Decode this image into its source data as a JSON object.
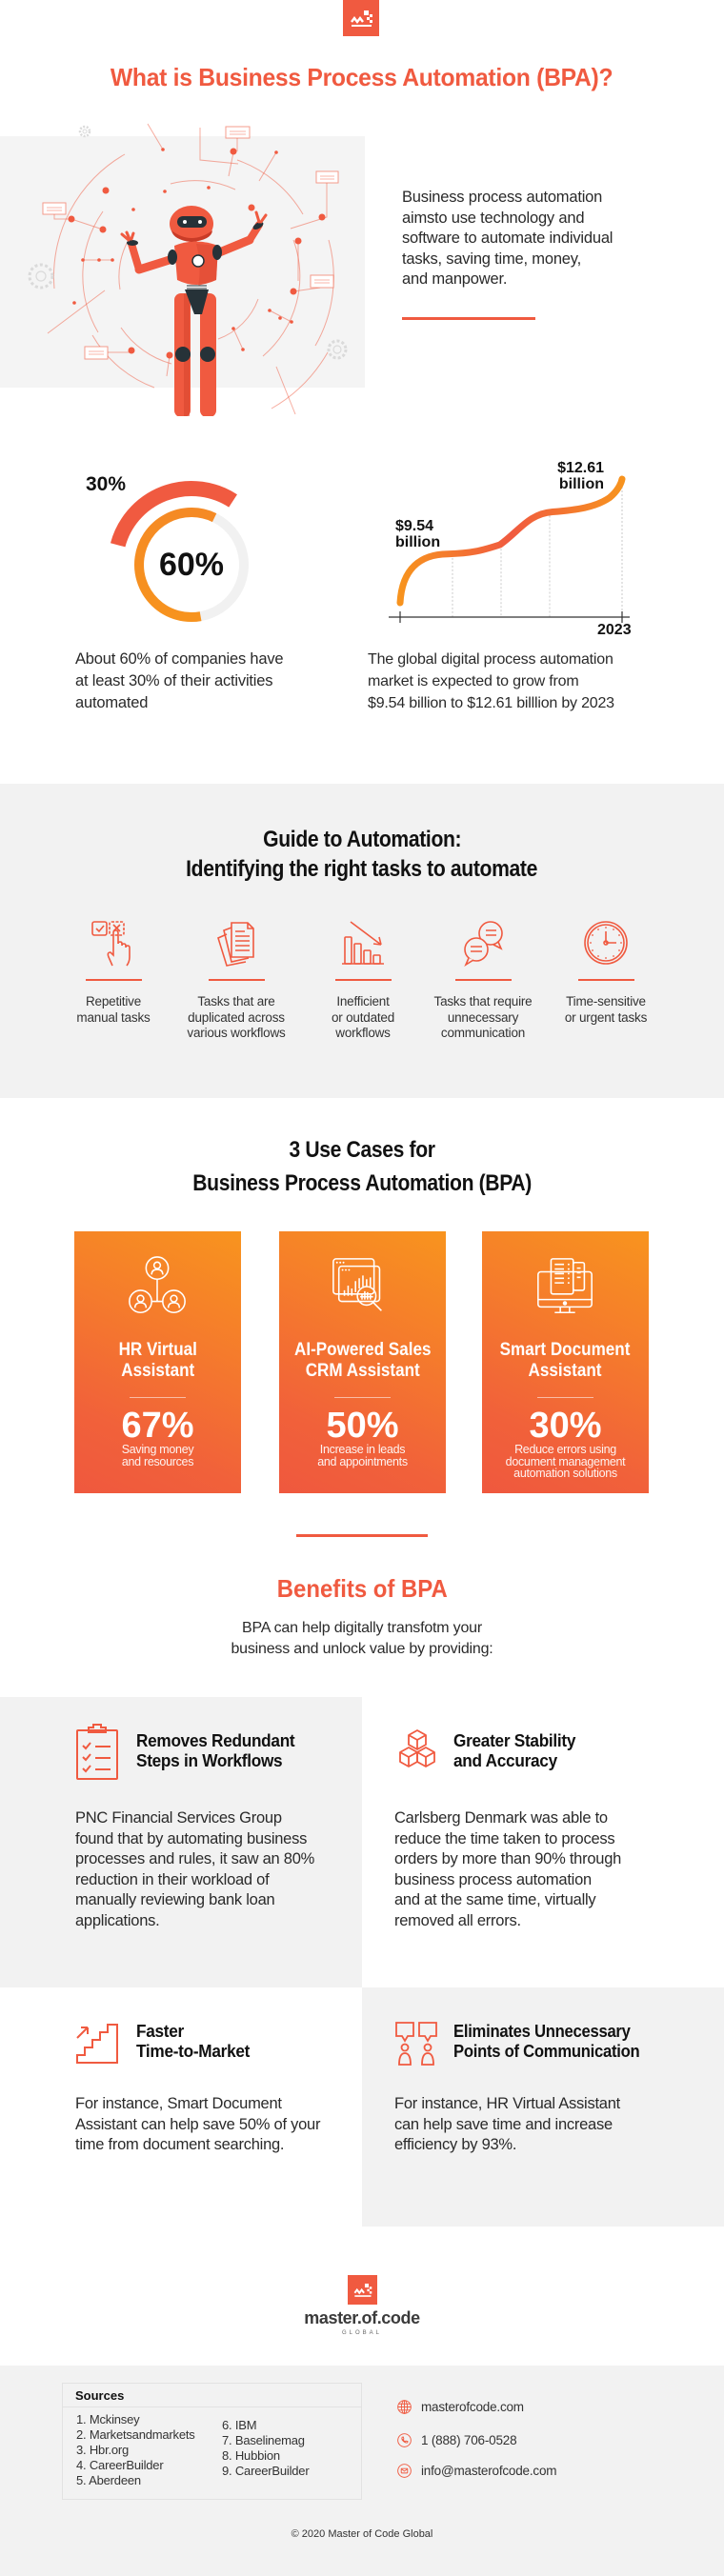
{
  "brand": {
    "name": "master.of.code",
    "tagline": "GLOBAL",
    "colors": {
      "primary": "#F05A40",
      "secondary": "#F7931E",
      "background_gray": "#F2F2F2",
      "text": "#222222"
    }
  },
  "hero": {
    "title": "What is Business Process Automation (BPA)?",
    "description": "Business process automation\naimsto use technology and\nsoftware to automate individual\ntasks, saving time, money,\nand manpower."
  },
  "stats": {
    "automation_share": {
      "outer_label": "30%",
      "inner_label": "60%",
      "description": "About 60% of companies have\nat least 30% of their activities\nautomated"
    },
    "market_growth": {
      "start_label": "$9.54\nbillion",
      "end_label": "$12.61\nbillion",
      "x_tick": "2023",
      "description": "The global digital process automation\nmarket is expected to grow from\n$9.54 billion to $12.61 billlion by 2023"
    }
  },
  "chart_data": [
    {
      "type": "pie",
      "variant": "donut",
      "title": "",
      "series": [
        {
          "name": "Companies with at least 30% of activities automated",
          "value": 60,
          "label": "60%",
          "ring": "inner"
        },
        {
          "name": "Share of activities automated",
          "value": 30,
          "label": "30%",
          "ring": "outer"
        }
      ]
    },
    {
      "type": "line",
      "title": "",
      "x": [
        "start",
        "2023"
      ],
      "xtick_labels": [
        "",
        "2023"
      ],
      "series": [
        {
          "name": "Global digital process automation market (USD billion)",
          "values": [
            9.54,
            12.61
          ]
        }
      ],
      "data_labels": [
        "$9.54 billion",
        "$12.61 billion"
      ],
      "xlabel": "",
      "ylabel": "",
      "grid": "vertical dashed"
    }
  ],
  "guide": {
    "title_line1": "Guide to Automation:",
    "title_line2": "Identifying the right tasks to automate",
    "items": [
      {
        "icon": "checkbox-hand-icon",
        "label": "Repetitive\nmanual tasks"
      },
      {
        "icon": "documents-icon",
        "label": "Tasks that are\nduplicated across\nvarious workflows"
      },
      {
        "icon": "declining-chart-icon",
        "label": "Inefficient\nor outdated\nworkflows"
      },
      {
        "icon": "chat-bubbles-icon",
        "label": "Tasks that require\nunnecessary\ncommunication"
      },
      {
        "icon": "clock-icon",
        "label": "Time-sensitive\nor urgent tasks"
      }
    ]
  },
  "use_cases": {
    "title_line1": "3 Use Cases for",
    "title_line2": "Business Process Automation (BPA)",
    "cards": [
      {
        "icon": "team-network-icon",
        "title": "HR Virtual\nAssistant",
        "stat": "67%",
        "caption": "Saving money\nand resources"
      },
      {
        "icon": "analytics-search-icon",
        "title": "AI-Powered Sales\nCRM Assistant",
        "stat": "50%",
        "caption": "Increase in leads\nand appointments"
      },
      {
        "icon": "monitor-documents-icon",
        "title": "Smart Document\nAssistant",
        "stat": "30%",
        "caption": "Reduce errors using\ndocument management\nautomation solutions"
      }
    ]
  },
  "benefits": {
    "title": "Benefits of BPA",
    "subtitle": "BPA can help digitally transfotm your\nbusiness and unlock value by providing:",
    "items": [
      {
        "icon": "clipboard-checklist-icon",
        "title": "Removes Redundant\nSteps in Workflows",
        "body": "PNC Financial Services Group\nfound that by automating business\nprocesses and rules, it saw an 80%\nreduction in their workload of\nmanually reviewing bank loan\napplications."
      },
      {
        "icon": "cubes-icon",
        "title": "Greater Stability\nand Accuracy",
        "body": "Carlsberg Denmark was able to\nreduce the time taken to process\norders by more than 90% through\nbusiness process automation\nand at the same time, virtually\nremoved all errors."
      },
      {
        "icon": "stairs-arrow-icon",
        "title": "Faster\nTime-to-Market",
        "body": "For instance, Smart Document\nAssistant can help save 50% of your\ntime from document searching."
      },
      {
        "icon": "people-chat-icon",
        "title": "Eliminates Unnecessary\nPoints of Communication",
        "body": "For instance, HR Virtual Assistant\ncan help save time and increase\nefficiency by 93%."
      }
    ]
  },
  "footer": {
    "sources_title": "Sources",
    "sources_col1": [
      "1. Mckinsey",
      "2. Marketsandmarkets",
      "3. Hbr.org",
      "4. CareerBuilder",
      "5. Aberdeen"
    ],
    "sources_col2": [
      "6. IBM",
      "7. Baselinemag",
      "8. Hubbion",
      "9. CareerBuilder"
    ],
    "contacts": [
      {
        "icon": "globe-icon",
        "text": "masterofcode.com"
      },
      {
        "icon": "phone-icon",
        "text": "1 (888) 706-0528"
      },
      {
        "icon": "envelope-icon",
        "text": "info@masterofcode.com"
      }
    ],
    "copyright": "© 2020 Master of Code Global"
  }
}
